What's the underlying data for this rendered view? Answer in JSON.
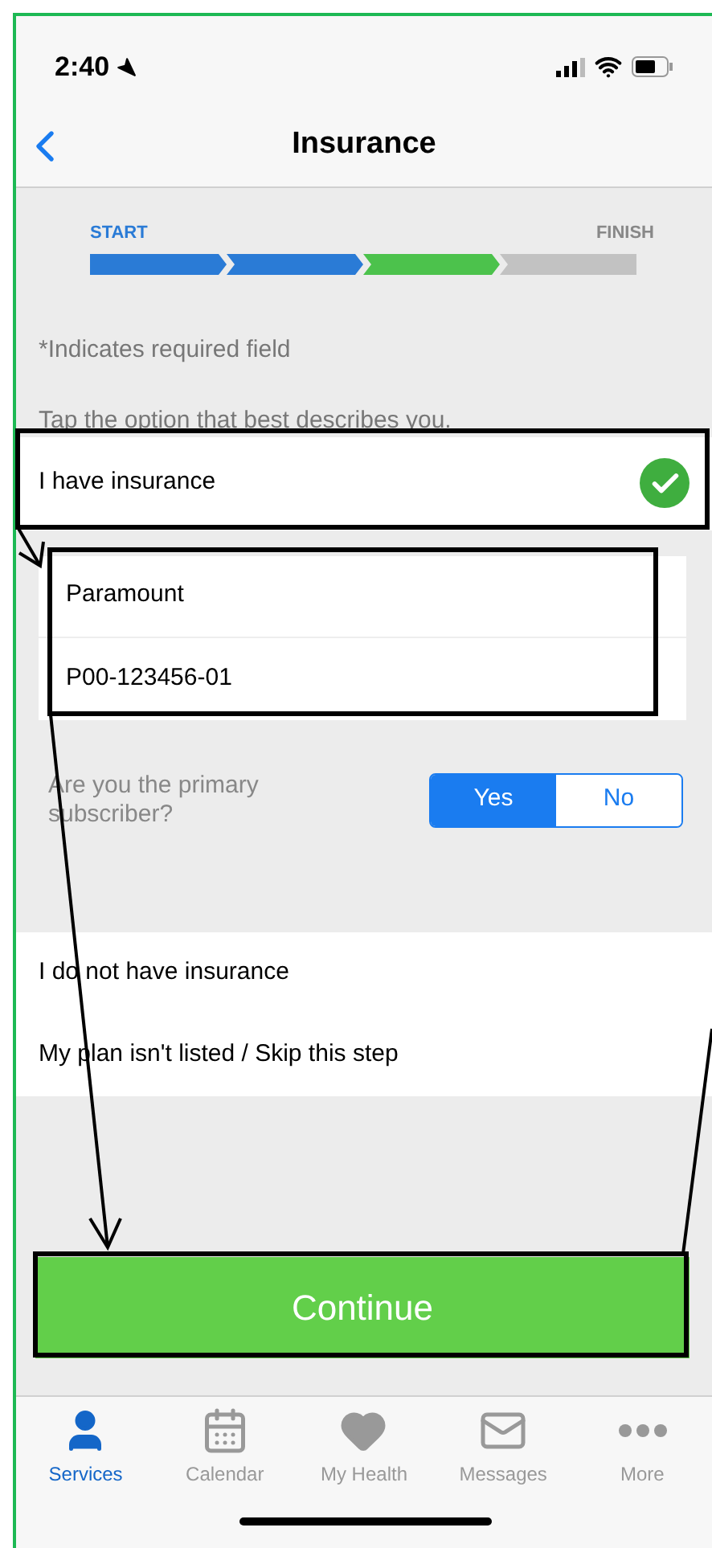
{
  "status_bar": {
    "time": "2:40"
  },
  "nav": {
    "title": "Insurance"
  },
  "progress": {
    "start_label": "START",
    "finish_label": "FINISH",
    "steps": [
      {
        "kind": "done"
      },
      {
        "kind": "done"
      },
      {
        "kind": "current"
      },
      {
        "kind": "todo"
      }
    ]
  },
  "required_note": "*Indicates required field",
  "prompt": "Tap the option that best describes you.",
  "selected_option": {
    "label": "I have insurance",
    "selected": true
  },
  "insurance_details": {
    "plan": "Paramount",
    "member_id": "P00-123456-01"
  },
  "primary_subscriber": {
    "question": "Are you the primary subscriber?",
    "options": [
      {
        "label": "Yes",
        "selected": true
      },
      {
        "label": "No",
        "selected": false
      }
    ]
  },
  "other_options": [
    {
      "label": "I do not have insurance",
      "selected": false
    },
    {
      "label": "My plan isn't listed / Skip this step",
      "selected": false
    }
  ],
  "continue_button": "Continue",
  "tab_bar": [
    {
      "kind": "person",
      "label": "Services",
      "selected": true
    },
    {
      "kind": "calendar",
      "label": "Calendar",
      "selected": false
    },
    {
      "kind": "heart",
      "label": "My Health",
      "selected": false
    },
    {
      "kind": "mail",
      "label": "Messages",
      "selected": false
    },
    {
      "kind": "more",
      "label": "More",
      "selected": false
    }
  ]
}
